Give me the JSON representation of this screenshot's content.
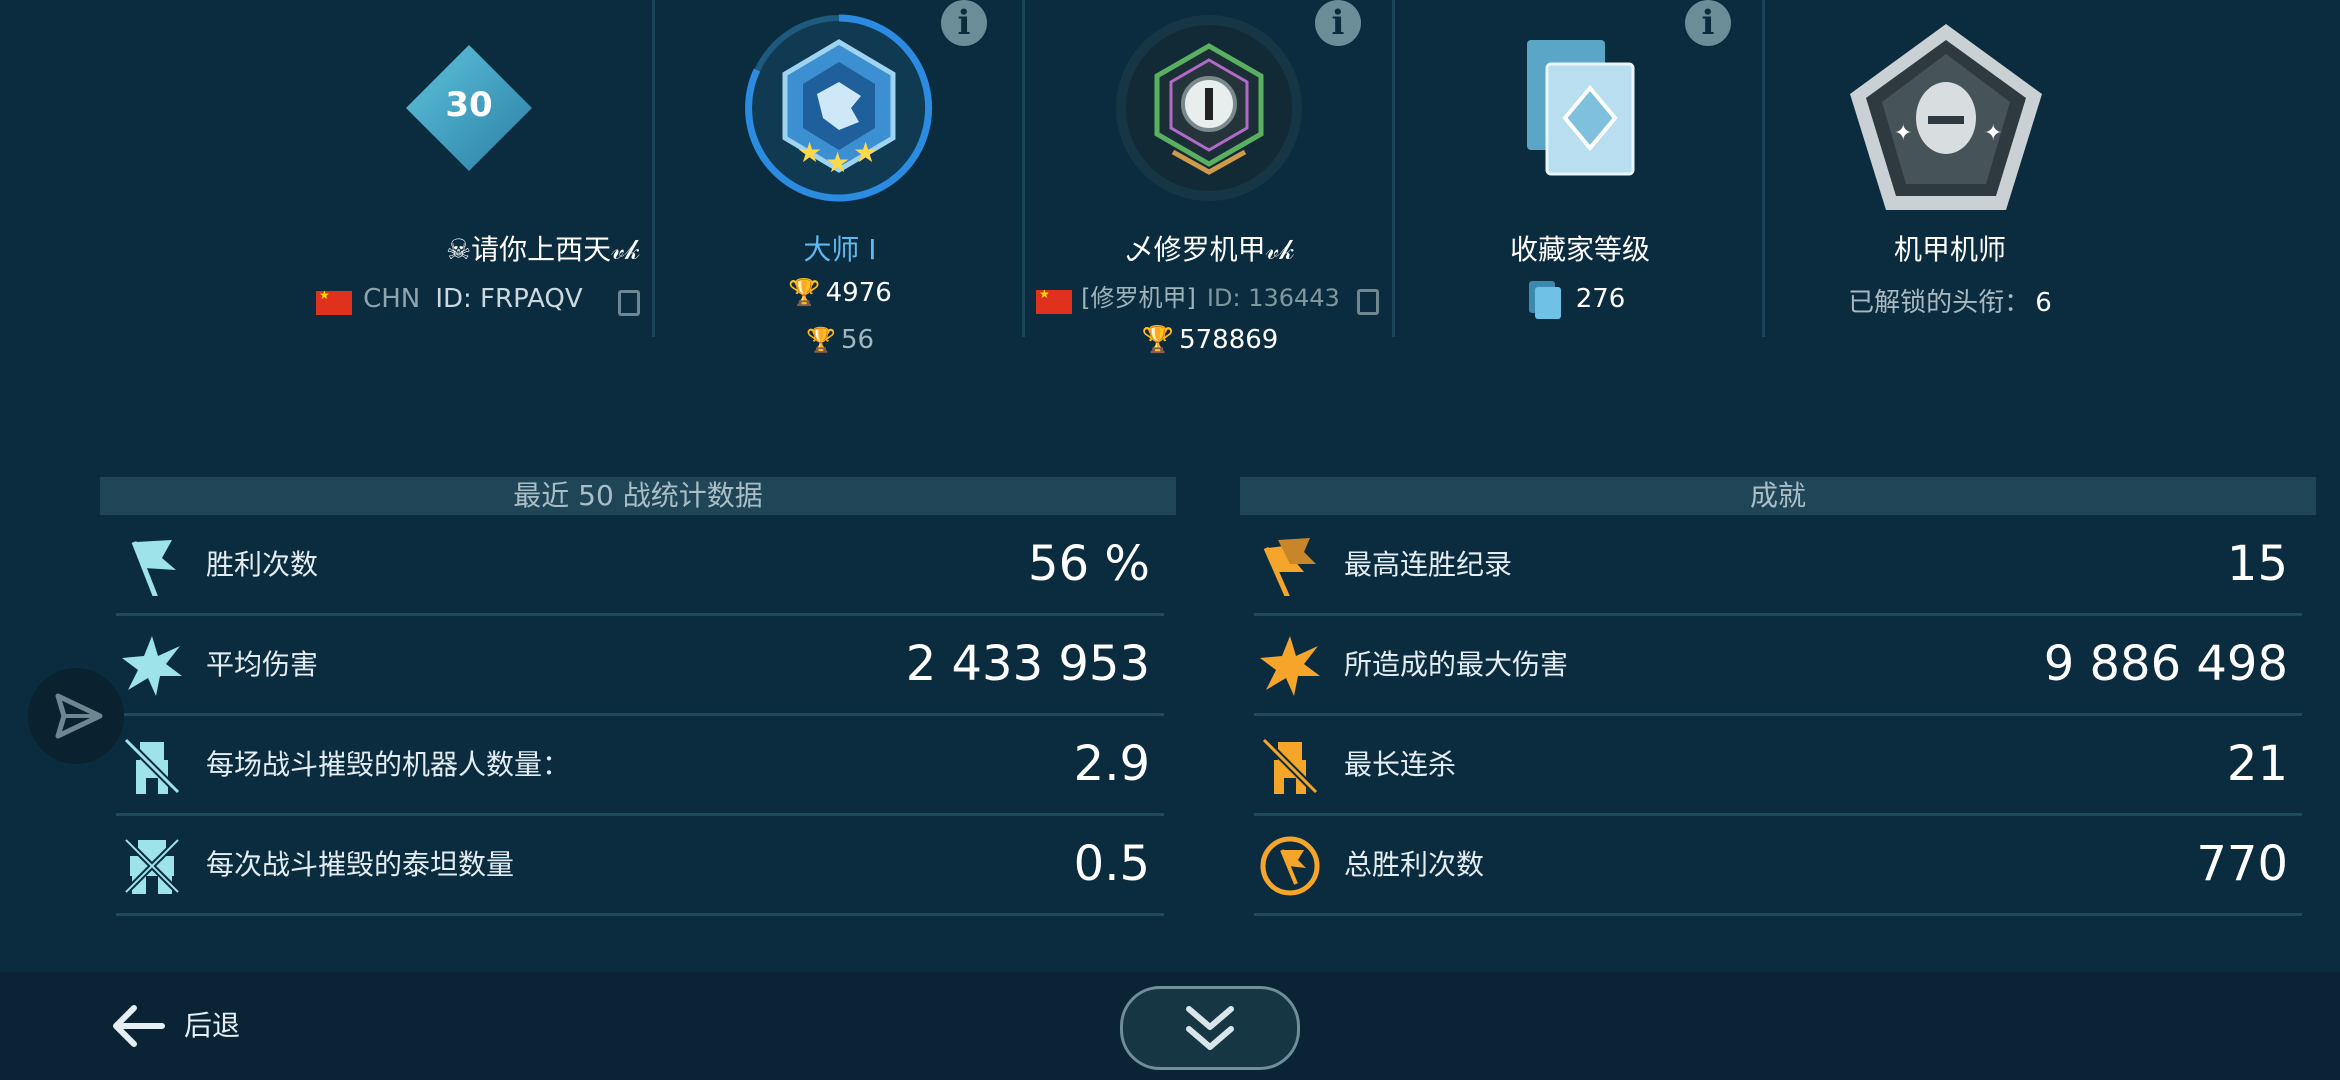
{
  "player": {
    "level": "30",
    "name": "☠请你上西天𝓋𝓀",
    "country": "CHN",
    "id": "ID: FRPAQV"
  },
  "league": {
    "title": "大师 I",
    "trophies": "4976",
    "sub_trophies": "56"
  },
  "clan": {
    "title": "乄修罗机甲𝓋𝓀",
    "tag": "[修罗机甲]",
    "id": "ID: 136443",
    "trophies": "578869"
  },
  "collector": {
    "title": "收藏家等级",
    "value": "276"
  },
  "pilot": {
    "title": "机甲机师",
    "label": "已解锁的头衔：",
    "value": "6"
  },
  "stats": {
    "header": "最近 50 战统计数据",
    "rows": [
      {
        "label": "胜利次数",
        "value": "56 %"
      },
      {
        "label": "平均伤害",
        "value": "2 433 953"
      },
      {
        "label": "每场战斗摧毁的机器人数量：",
        "value": "2.9"
      },
      {
        "label": "每次战斗摧毁的泰坦数量",
        "value": "0.5"
      }
    ]
  },
  "achievements": {
    "header": "成就",
    "rows": [
      {
        "label": "最高连胜纪录",
        "value": "15"
      },
      {
        "label": "所造成的最大伤害",
        "value": "9 886 498"
      },
      {
        "label": "最长连杀",
        "value": "21"
      },
      {
        "label": "总胜利次数",
        "value": "770"
      }
    ]
  },
  "footer": {
    "back_label": "后退"
  },
  "colors": {
    "background": "#0b2b3e",
    "accent_blue": "#2a8be0",
    "accent_orange": "#f4a52a",
    "stat_icon": "#9ee3ea"
  }
}
